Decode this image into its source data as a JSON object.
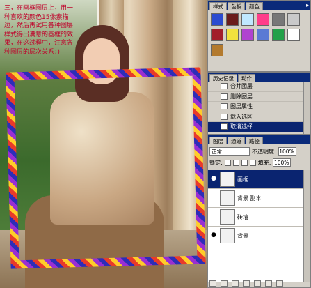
{
  "canvas": {
    "intro_text": "三，在画框图层上，用一种喜欢的颜色15像素描边，然后再试用各种图层样式得出满意的画框的效果，在这过程中，注意各种图层的层次关系：)",
    "watermark": "eNet3957"
  },
  "styles_panel": {
    "tabs": [
      "样式",
      "色板",
      "颜色"
    ],
    "swatch_colors": [
      "#2b4bd0",
      "#6a1c1c",
      "#c0e8ff",
      "#ff3e8a",
      "#777777",
      "#c9c9c9",
      "#a21e2b",
      "#f2e23d",
      "#b043d0",
      "#5a7ad4",
      "#23a04a",
      "#ffffff",
      "#b37a2e"
    ]
  },
  "history_panel": {
    "tabs": [
      "历史记录",
      "动作"
    ],
    "items": [
      {
        "label": "合并图层"
      },
      {
        "label": "删除图层"
      },
      {
        "label": "图层属性"
      },
      {
        "label": "载入选区"
      },
      {
        "label": "取消选择",
        "selected": true
      }
    ]
  },
  "layers_panel": {
    "tabs": [
      "图层",
      "通道",
      "路径"
    ],
    "blend_mode": "正常",
    "opacity_label": "不透明度:",
    "opacity_value": "100%",
    "lock_label": "锁定:",
    "fill_label": "填充:",
    "fill_value": "100%",
    "layers": [
      {
        "name": "画框",
        "selected": true,
        "visible": true
      },
      {
        "name": "背景 副本",
        "selected": false,
        "visible": false
      },
      {
        "name": "砖墙",
        "selected": false,
        "visible": false
      },
      {
        "name": "背景",
        "selected": false,
        "visible": true
      }
    ]
  }
}
